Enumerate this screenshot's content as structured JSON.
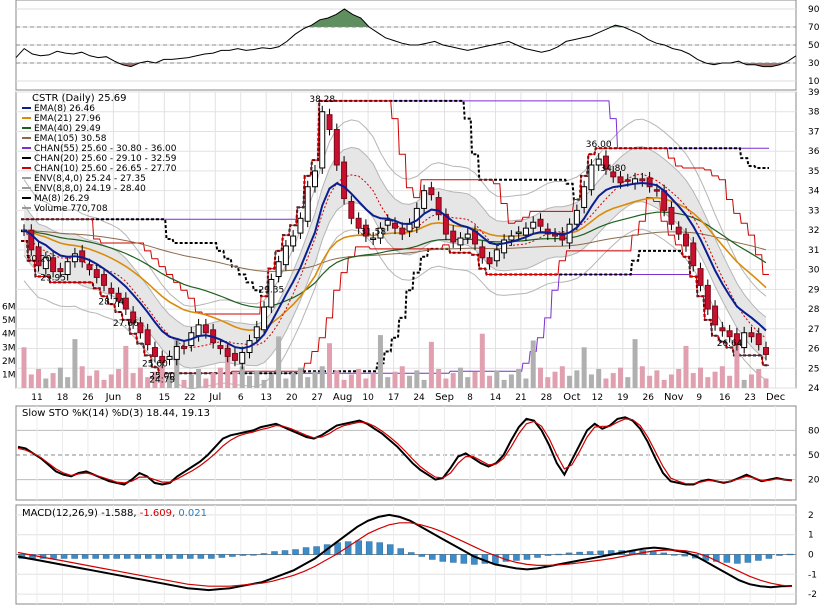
{
  "chart_data": [
    {
      "panel": "rsi",
      "type": "line",
      "y_ticks": [
        "90",
        "70",
        "50",
        "30",
        "10"
      ],
      "ylim": [
        0,
        100
      ],
      "overbought": 70,
      "oversold": 30,
      "series": [
        {
          "values": [
            36,
            46,
            40,
            38,
            39,
            43,
            41,
            40,
            42,
            38,
            36,
            37,
            32,
            28,
            26,
            30,
            32,
            30,
            34,
            34,
            35,
            36,
            38,
            40,
            41,
            44,
            44,
            46,
            44,
            45,
            47,
            46,
            48,
            54,
            62,
            68,
            72,
            78,
            80,
            84,
            90,
            84,
            80,
            70,
            64,
            58,
            55,
            52,
            50,
            50,
            52,
            54,
            50,
            48,
            46,
            44,
            46,
            48,
            50,
            52,
            54,
            50,
            46,
            44,
            42,
            44,
            48,
            54,
            56,
            58,
            60,
            64,
            68,
            72,
            70,
            66,
            62,
            56,
            52,
            50,
            46,
            44,
            40,
            34,
            30,
            28,
            30,
            30,
            32,
            28,
            28,
            26,
            26,
            28,
            32,
            38
          ]
        }
      ]
    },
    {
      "panel": "price",
      "type": "candlestick",
      "title": "CSTR (Daily) 25.69",
      "x_tick_labels": [
        "11",
        "18",
        "26",
        "Jun",
        "8",
        "15",
        "22",
        "Jul",
        "6",
        "13",
        "20",
        "27",
        "Aug",
        "10",
        "17",
        "24",
        "Sep",
        "8",
        "14",
        "21",
        "28",
        "Oct",
        "12",
        "19",
        "26",
        "Nov",
        "9",
        "16",
        "23",
        "Dec"
      ],
      "y_ticks": [
        "39",
        "38",
        "37",
        "36",
        "35",
        "34",
        "33",
        "32",
        "31",
        "30",
        "29",
        "28",
        "27",
        "26",
        "25",
        "24"
      ],
      "ylim": [
        24,
        39
      ],
      "volume_ticks": [
        "6M",
        "5M",
        "4M",
        "3M",
        "2M",
        "1M"
      ],
      "close": [
        32.0,
        31.0,
        30.2,
        30.6,
        29.9,
        29.9,
        30.4,
        30.8,
        30.4,
        30.0,
        29.6,
        29.2,
        28.8,
        28.4,
        28.0,
        27.3,
        26.8,
        26.2,
        25.6,
        25.3,
        25.6,
        26.1,
        26.0,
        26.8,
        27.2,
        26.8,
        26.3,
        26.0,
        25.6,
        25.4,
        25.8,
        26.4,
        27.1,
        28.1,
        29.5,
        30.4,
        31.2,
        31.7,
        32.6,
        34.2,
        35.0,
        38.0,
        37.1,
        35.3,
        33.6,
        32.6,
        32.1,
        31.7,
        31.6,
        32.1,
        32.5,
        32.1,
        31.8,
        32.3,
        33.1,
        34.0,
        33.8,
        32.8,
        31.8,
        31.4,
        31.6,
        31.8,
        31.3,
        30.6,
        30.3,
        31.0,
        31.5,
        31.7,
        31.9,
        32.1,
        32.4,
        32.2,
        31.8,
        31.7,
        31.5,
        32.3,
        33.0,
        34.2,
        35.3,
        35.6,
        35.1,
        34.7,
        34.4,
        34.5,
        34.6,
        34.5,
        34.2,
        34.0,
        33.0,
        32.3,
        31.8,
        31.2,
        30.2,
        29.2,
        28.0,
        27.2,
        26.9,
        26.6,
        26.2,
        26.8,
        26.6,
        26.2,
        25.7
      ],
      "annotations": [
        {
          "text": "31.58",
          "value": 31.58
        },
        {
          "text": "28.74",
          "value": 28.74
        },
        {
          "text": "27.66",
          "value": 27.66
        },
        {
          "text": "25.00",
          "value": 25.0
        },
        {
          "text": "24.79",
          "value": 24.79
        },
        {
          "text": "38.28",
          "value": 38.28
        },
        {
          "text": "34.80",
          "value": 34.8
        },
        {
          "text": "30.20",
          "value": 30.2
        },
        {
          "text": "29.95",
          "value": 29.95
        },
        {
          "text": "36.00",
          "value": 36.0
        },
        {
          "text": "29.35",
          "value": 29.35
        },
        {
          "text": "26.64",
          "value": 26.64
        },
        {
          "text": "25.60",
          "value": 25.6
        }
      ],
      "legend": [
        {
          "label": "EMA(8) 26.46",
          "color": "#0b1e8f"
        },
        {
          "label": "EMA(21) 27.96",
          "color": "#d98c0a"
        },
        {
          "label": "EMA(40) 29.49",
          "color": "#1e5e1e"
        },
        {
          "label": "EMA(105) 30.58",
          "color": "#8a6a4a"
        },
        {
          "label": "CHAN(55) 25.60 - 30.80 - 36.00",
          "color": "#7b2fd1"
        },
        {
          "label": "CHAN(20) 25.60 - 29.10 - 32.59",
          "color": "#000000"
        },
        {
          "label": "CHAN(10) 25.60 - 26.65 - 27.70",
          "color": "#d00000"
        },
        {
          "label": "ENV(8,4,0) 25.24 - 27.35",
          "color": "#9a9a9a"
        },
        {
          "label": "ENV(8,8,0) 24.19 - 28.40",
          "color": "#9a9a9a"
        },
        {
          "label": "MA(8) 26.29",
          "color": "#000000"
        },
        {
          "label": "Volume 770,708",
          "color": "#999999"
        }
      ]
    },
    {
      "panel": "stochastic",
      "type": "line",
      "title": "Slow STO %K(14) %D(3) 18.44, 19.13",
      "y_ticks": [
        "80",
        "50",
        "20"
      ],
      "ylim": [
        0,
        100
      ],
      "series": [
        {
          "name": "%K(14)",
          "color": "#000000",
          "values": [
            60,
            58,
            52,
            46,
            38,
            30,
            26,
            24,
            28,
            30,
            26,
            22,
            18,
            16,
            14,
            20,
            28,
            24,
            16,
            14,
            16,
            24,
            30,
            36,
            42,
            50,
            60,
            70,
            74,
            76,
            78,
            80,
            84,
            86,
            88,
            84,
            80,
            76,
            72,
            70,
            74,
            80,
            86,
            88,
            90,
            92,
            88,
            82,
            76,
            68,
            60,
            50,
            40,
            32,
            26,
            20,
            22,
            34,
            48,
            52,
            46,
            40,
            36,
            40,
            50,
            68,
            84,
            94,
            92,
            80,
            62,
            40,
            26,
            44,
            62,
            80,
            88,
            82,
            86,
            94,
            96,
            92,
            82,
            66,
            46,
            28,
            18,
            16,
            14,
            14,
            18,
            20,
            18,
            16,
            18,
            22,
            26,
            22,
            18,
            20,
            22,
            20,
            19
          ]
        },
        {
          "name": "%D(3)",
          "color": "#d00000",
          "values": [
            58,
            56,
            52,
            47,
            40,
            33,
            28,
            25,
            27,
            28,
            26,
            23,
            20,
            17,
            16,
            18,
            23,
            23,
            20,
            17,
            17,
            21,
            26,
            31,
            37,
            44,
            52,
            61,
            68,
            73,
            76,
            78,
            81,
            83,
            86,
            85,
            82,
            78,
            74,
            71,
            72,
            76,
            82,
            86,
            88,
            90,
            89,
            85,
            79,
            72,
            64,
            55,
            45,
            36,
            29,
            23,
            22,
            28,
            40,
            48,
            48,
            43,
            38,
            39,
            46,
            60,
            76,
            88,
            91,
            85,
            70,
            50,
            33,
            38,
            54,
            72,
            84,
            85,
            85,
            90,
            94,
            93,
            86,
            72,
            54,
            36,
            22,
            18,
            15,
            15,
            17,
            19,
            18,
            17,
            18,
            21,
            24,
            22,
            19,
            19,
            21,
            20,
            19
          ]
        }
      ]
    },
    {
      "panel": "macd",
      "type": "line",
      "title_label": "MACD(12,26,9)",
      "values_text": [
        "-1.588",
        "-1.609",
        "0.021"
      ],
      "value_colors": [
        "#000000",
        "#d00000",
        "#2a7fc0"
      ],
      "y_ticks": [
        "2",
        "1",
        "0",
        "-1",
        "-2"
      ],
      "ylim": [
        -2.5,
        2.5
      ],
      "series": [
        {
          "name": "MACD",
          "color": "#000000",
          "values": [
            -0.1,
            -0.2,
            -0.3,
            -0.4,
            -0.5,
            -0.6,
            -0.7,
            -0.8,
            -0.9,
            -1.0,
            -1.1,
            -1.2,
            -1.3,
            -1.4,
            -1.5,
            -1.6,
            -1.7,
            -1.75,
            -1.8,
            -1.75,
            -1.7,
            -1.6,
            -1.5,
            -1.4,
            -1.2,
            -1.0,
            -0.8,
            -0.5,
            -0.2,
            0.2,
            0.6,
            1.0,
            1.4,
            1.7,
            1.9,
            2.0,
            1.9,
            1.7,
            1.4,
            1.1,
            0.8,
            0.5,
            0.2,
            -0.1,
            -0.3,
            -0.5,
            -0.6,
            -0.7,
            -0.75,
            -0.7,
            -0.6,
            -0.5,
            -0.4,
            -0.3,
            -0.2,
            -0.1,
            0.0,
            0.1,
            0.2,
            0.3,
            0.35,
            0.3,
            0.2,
            0.1,
            -0.1,
            -0.4,
            -0.7,
            -1.0,
            -1.3,
            -1.5,
            -1.6,
            -1.65,
            -1.6,
            -1.59
          ]
        },
        {
          "name": "Signal",
          "color": "#d00000",
          "values": [
            0.1,
            0.0,
            -0.1,
            -0.2,
            -0.3,
            -0.4,
            -0.5,
            -0.6,
            -0.7,
            -0.8,
            -0.9,
            -1.0,
            -1.1,
            -1.2,
            -1.3,
            -1.4,
            -1.5,
            -1.55,
            -1.6,
            -1.6,
            -1.6,
            -1.55,
            -1.5,
            -1.45,
            -1.35,
            -1.2,
            -1.05,
            -0.85,
            -0.6,
            -0.3,
            0.0,
            0.35,
            0.7,
            1.05,
            1.3,
            1.5,
            1.6,
            1.6,
            1.5,
            1.35,
            1.15,
            0.9,
            0.65,
            0.4,
            0.15,
            -0.05,
            -0.25,
            -0.4,
            -0.5,
            -0.55,
            -0.55,
            -0.52,
            -0.48,
            -0.42,
            -0.35,
            -0.28,
            -0.2,
            -0.1,
            0.0,
            0.1,
            0.18,
            0.22,
            0.22,
            0.18,
            0.08,
            -0.1,
            -0.35,
            -0.6,
            -0.85,
            -1.1,
            -1.3,
            -1.45,
            -1.55,
            -1.61
          ]
        },
        {
          "name": "Histogram",
          "color": "#2a7fc0",
          "values": [
            -0.2,
            -0.2,
            -0.2,
            -0.2,
            -0.2,
            -0.2,
            -0.2,
            -0.2,
            -0.2,
            -0.2,
            -0.2,
            -0.2,
            -0.2,
            -0.2,
            -0.2,
            -0.2,
            -0.2,
            -0.2,
            -0.2,
            -0.15,
            -0.1,
            -0.05,
            0.0,
            0.05,
            0.15,
            0.2,
            0.25,
            0.35,
            0.4,
            0.5,
            0.6,
            0.65,
            0.7,
            0.65,
            0.6,
            0.5,
            0.3,
            0.1,
            -0.1,
            -0.25,
            -0.35,
            -0.4,
            -0.45,
            -0.5,
            -0.45,
            -0.45,
            -0.35,
            -0.3,
            -0.25,
            -0.15,
            -0.05,
            0.02,
            0.08,
            0.12,
            0.15,
            0.18,
            0.2,
            0.2,
            0.2,
            0.2,
            0.17,
            0.08,
            -0.02,
            -0.08,
            -0.18,
            -0.3,
            -0.35,
            -0.4,
            -0.45,
            -0.4,
            -0.3,
            -0.2,
            -0.05,
            0.02
          ]
        }
      ]
    }
  ]
}
